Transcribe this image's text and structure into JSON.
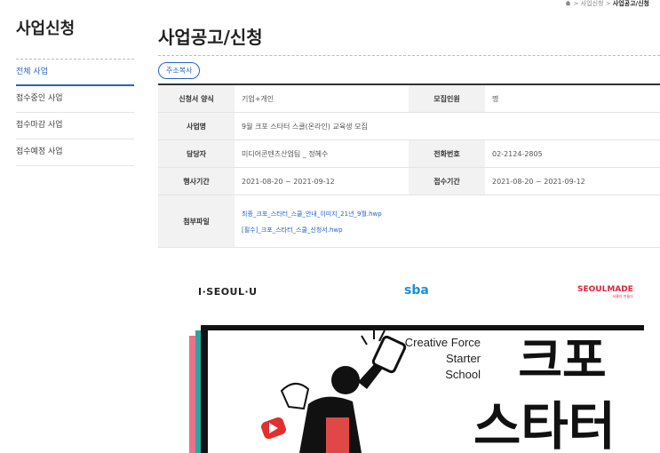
{
  "breadcrumb": {
    "sep1": ">",
    "item1": "사업신청",
    "sep2": ">",
    "current": "사업공고/신청"
  },
  "sidebar": {
    "title": "사업신청",
    "items": [
      {
        "label": "전체 사업",
        "active": true
      },
      {
        "label": "접수중인 사업"
      },
      {
        "label": "접수마감 사업"
      },
      {
        "label": "접수예정 사업"
      }
    ]
  },
  "main": {
    "title": "사업공고/신청",
    "copy_button": "주소복사",
    "rows": {
      "form_label": "신청서 양식",
      "form_value": "기업+개인",
      "recruit_label": "모집인원",
      "recruit_value": "명",
      "name_label": "사업명",
      "name_value": "9월 크포 스타터 스쿨(온라인) 교육생 모집",
      "manager_label": "담당자",
      "manager_value": "미디어콘텐츠산업팀 _ 정혜수",
      "phone_label": "전화번호",
      "phone_value": "02-2124-2805",
      "period_label": "행사기간",
      "period_value": "2021-08-20 ~ 2021-09-12",
      "apply_label": "접수기간",
      "apply_value": "2021-08-20 ~ 2021-09-12",
      "files_label": "첨부파일",
      "files": [
        "최종_크포_스타터_스쿨_안내_이미지_21년_9월.hwp",
        "[필수]_크포_스타터_스쿨_신청서.hwp"
      ]
    }
  },
  "logos": {
    "seoul": "I·SEOUL·U",
    "sba": "sba",
    "seoulmade": "SEOULMADE",
    "seoulmade_sub": "서울이 만들다"
  },
  "banner": {
    "line1": "Creative Force",
    "line2": "Starter",
    "line3": "School",
    "big1": "크포",
    "big2": "스타터"
  },
  "colors": {
    "accent": "#2563c9",
    "banner_black": "#111111",
    "pink": "#e8728a",
    "teal": "#2aa6a0",
    "red": "#d9253d"
  }
}
